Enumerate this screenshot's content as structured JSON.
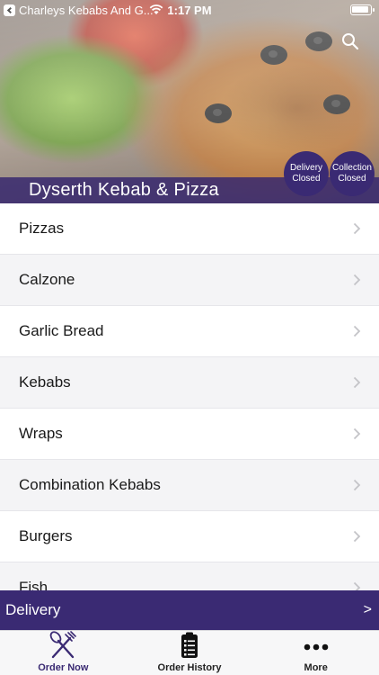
{
  "status_bar": {
    "app_name": "Charleys Kebabs And G...",
    "time": "1:17 PM"
  },
  "header": {
    "restaurant_name": "Dyserth Kebab & Pizza",
    "delivery_status": [
      "Delivery",
      "Closed"
    ],
    "collection_status": [
      "Collection",
      "Closed"
    ]
  },
  "menu": {
    "items": [
      {
        "label": "Pizzas"
      },
      {
        "label": "Calzone"
      },
      {
        "label": "Garlic Bread"
      },
      {
        "label": "Kebabs"
      },
      {
        "label": "Wraps"
      },
      {
        "label": "Combination Kebabs"
      },
      {
        "label": "Burgers"
      },
      {
        "label": "Fish"
      }
    ]
  },
  "delivery_bar": {
    "label": "Delivery",
    "arrow": ">"
  },
  "tabs": [
    {
      "label": "Order Now",
      "icon": "fork-knife-icon",
      "active": true
    },
    {
      "label": "Order History",
      "icon": "clipboard-icon",
      "active": false
    },
    {
      "label": "More",
      "icon": "more-dots-icon",
      "active": false
    }
  ],
  "colors": {
    "brand": "#3a2a73",
    "row_alt": "#f4f4f6"
  }
}
